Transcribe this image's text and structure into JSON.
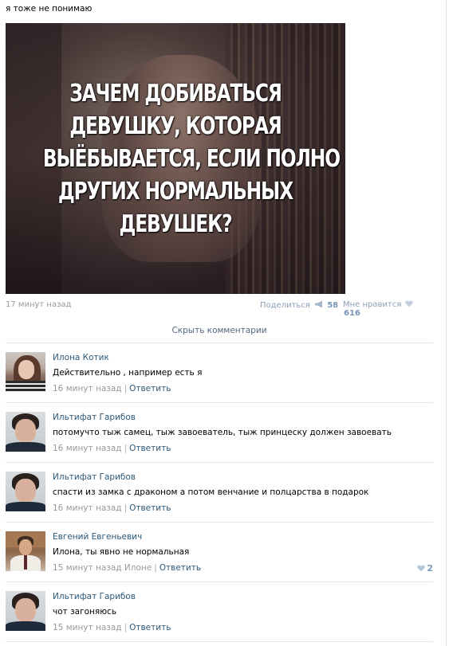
{
  "post": {
    "text": "я тоже не понимаю",
    "image_lines": [
      "ЗАЧЕМ ДОБИВАТЬСЯ",
      "ДЕВУШКУ, КОТОРАЯ",
      "ВЫЁБЫВАЕТСЯ, ЕСЛИ ПОЛНО",
      "ДРУГИХ НОРМАЛЬНЫХ",
      "ДЕВУШЕК?"
    ],
    "time": "17 минут назад",
    "share_label": "Поделиться",
    "share_count": "58",
    "like_label": "Мне нравится",
    "like_count": "616",
    "hide_comments": "Скрыть комментарии"
  },
  "colors": {
    "link": "#2b587a",
    "muted": "#999999",
    "accent": "#7a95b5"
  },
  "comments": [
    {
      "author": "Илона Котик",
      "text": "Действительно , например есть я",
      "time": "16 минут назад",
      "reply_to": "",
      "reply": "Ответить",
      "likes": "",
      "avatar": "girl-avatar"
    },
    {
      "author": "Ильтифат Гарибов",
      "text": "потомучто тыж самец, тыж завоеватель, тыж принцеску должен завоевать",
      "time": "16 минут назад",
      "reply_to": "",
      "reply": "Ответить",
      "likes": "",
      "avatar": "guy-avatar"
    },
    {
      "author": "Ильтифат Гарибов",
      "text": "спасти из замка с драконом а потом венчание и полцарства в подарок",
      "time": "16 минут назад",
      "reply_to": "",
      "reply": "Ответить",
      "likes": "",
      "avatar": "guy-avatar"
    },
    {
      "author": "Евгений Евгеньевич",
      "text": "Илона, ты явно не нормальная",
      "time": "15 минут назад",
      "reply_to": "Илоне",
      "reply": "Ответить",
      "likes": "2",
      "avatar": "man-avatar"
    },
    {
      "author": "Ильтифат Гарибов",
      "text": "чот загоняюсь",
      "time": "15 минут назад",
      "reply_to": "",
      "reply": "Ответить",
      "likes": "",
      "avatar": "guy-avatar"
    }
  ]
}
